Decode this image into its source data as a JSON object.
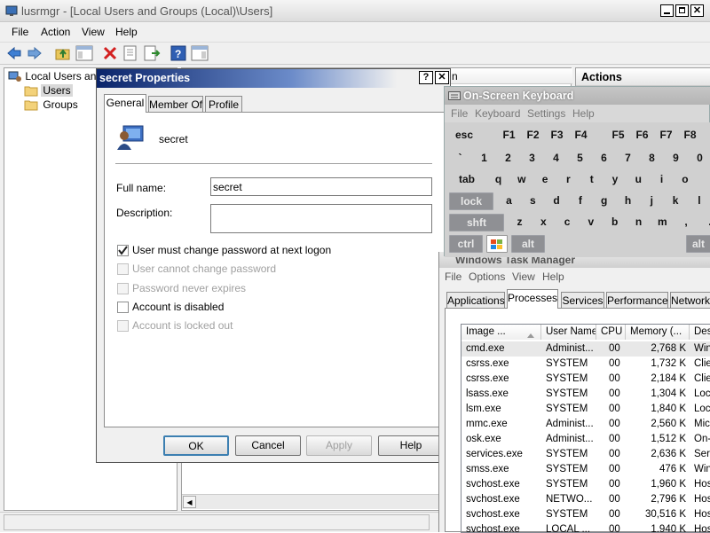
{
  "main_window": {
    "title": "lusrmgr - [Local Users and Groups (Local)\\Users]",
    "menu": [
      "File",
      "Action",
      "View",
      "Help"
    ],
    "tree": {
      "root": "Local Users and Groups (Local)",
      "children": [
        "Users",
        "Groups"
      ]
    },
    "actions_label": "Actions",
    "col_header_fragment": "n"
  },
  "properties": {
    "title": "secret Properties",
    "title_help": "?",
    "title_close": "✕",
    "tabs": [
      "General",
      "Member Of",
      "Profile"
    ],
    "user_name": "secret",
    "full_name_label": "Full name:",
    "full_name_value": "secret",
    "description_label": "Description:",
    "description_value": "",
    "checks": [
      {
        "label": "User must change password at next logon",
        "checked": true,
        "enabled": true
      },
      {
        "label": "User cannot change password",
        "checked": false,
        "enabled": false
      },
      {
        "label": "Password never expires",
        "checked": false,
        "enabled": false
      },
      {
        "label": "Account is disabled",
        "checked": false,
        "enabled": true
      },
      {
        "label": "Account is locked out",
        "checked": false,
        "enabled": false
      }
    ],
    "buttons": [
      "OK",
      "Cancel",
      "Apply",
      "Help"
    ]
  },
  "osk": {
    "title": "On-Screen Keyboard",
    "menu": [
      "File",
      "Keyboard",
      "Settings",
      "Help"
    ],
    "row1": [
      "esc",
      "F1",
      "F2",
      "F3",
      "F4",
      "F5",
      "F6",
      "F7",
      "F8"
    ],
    "row2": [
      "`",
      "1",
      "2",
      "3",
      "4",
      "5",
      "6",
      "7",
      "8",
      "9",
      "0"
    ],
    "row3": [
      "tab",
      "q",
      "w",
      "e",
      "r",
      "t",
      "y",
      "u",
      "i",
      "o"
    ],
    "row4": [
      "lock",
      "a",
      "s",
      "d",
      "f",
      "g",
      "h",
      "j",
      "k",
      "l"
    ],
    "row5": [
      "shft",
      "z",
      "x",
      "c",
      "v",
      "b",
      "n",
      "m",
      ",",
      "."
    ],
    "row6": [
      "ctrl",
      "alt",
      "alt"
    ]
  },
  "taskmgr": {
    "title": "Windows Task Manager",
    "menu": [
      "File",
      "Options",
      "View",
      "Help"
    ],
    "tabs": [
      "Applications",
      "Processes",
      "Services",
      "Performance",
      "Networking"
    ],
    "columns": [
      "Image ...",
      "User Name",
      "CPU",
      "Memory (...",
      "Desc"
    ],
    "rows": [
      [
        "cmd.exe",
        "Administ...",
        "00",
        "2,768 K",
        "Win"
      ],
      [
        "csrss.exe",
        "SYSTEM",
        "00",
        "1,732 K",
        "Clie"
      ],
      [
        "csrss.exe",
        "SYSTEM",
        "00",
        "2,184 K",
        "Clie"
      ],
      [
        "lsass.exe",
        "SYSTEM",
        "00",
        "1,304 K",
        "Loca"
      ],
      [
        "lsm.exe",
        "SYSTEM",
        "00",
        "1,840 K",
        "Loca"
      ],
      [
        "mmc.exe",
        "Administ...",
        "00",
        "2,560 K",
        "Micr"
      ],
      [
        "osk.exe",
        "Administ...",
        "00",
        "1,512 K",
        "On-"
      ],
      [
        "services.exe",
        "SYSTEM",
        "00",
        "2,636 K",
        "Serv"
      ],
      [
        "smss.exe",
        "SYSTEM",
        "00",
        "476 K",
        "Win"
      ],
      [
        "svchost.exe",
        "SYSTEM",
        "00",
        "1,960 K",
        "Hos"
      ],
      [
        "svchost.exe",
        "NETWO...",
        "00",
        "2,796 K",
        "Hos"
      ],
      [
        "svchost.exe",
        "SYSTEM",
        "00",
        "30,516 K",
        "Hos"
      ],
      [
        "svchost.exe",
        "LOCAL ...",
        "00",
        "1,940 K",
        "Hos"
      ]
    ]
  }
}
